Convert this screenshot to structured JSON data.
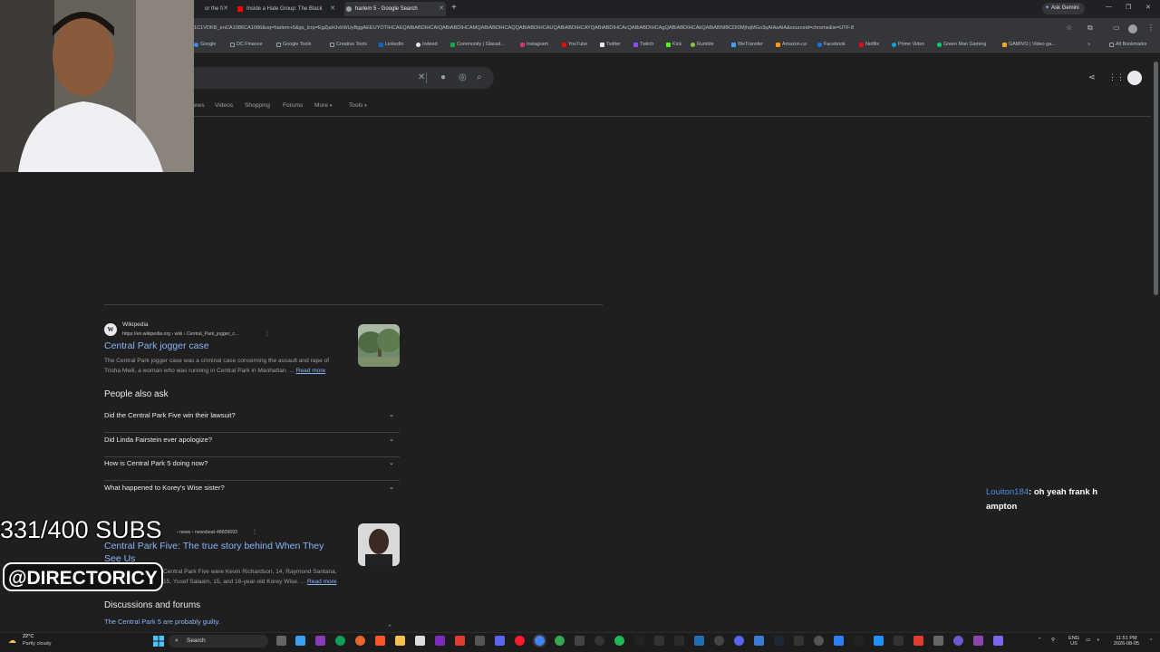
{
  "browser": {
    "tabs": [
      {
        "label": "or the fi",
        "close": "✕"
      },
      {
        "label": "Inside a Hate Group: The Black",
        "close": "✕"
      },
      {
        "label": "harlem 5 - Google Search",
        "close": "✕"
      }
    ],
    "new_tab": "+",
    "ask_gemini": "Ask Gemini",
    "window_controls": [
      "—",
      "❐",
      "✕"
    ],
    "url": "1C1VDKB_enCA1086CA1086&oq=harlem+5&gs_lcrp=EgZjaHJvbWUyBggAEEUYOTIHCAEQABiABDIHCAIQABiABDIHCAMQABiABDIHCAQQABiABDIHCAUQABiABDIHCAYQABiABDIHCAcQABiABDIHCAgQABiABDIHCAkQABiABNIBCDI0MjhqMGo3qAIAsAIA&sourceid=chrome&ie=UTF-8",
    "bookmarks": [
      {
        "label": "Google",
        "color": "#4285f4"
      },
      {
        "label": "DC Finance",
        "color": "#9aa0a6"
      },
      {
        "label": "Google Tools",
        "color": "#9aa0a6"
      },
      {
        "label": "Creative Tools",
        "color": "#9aa0a6"
      },
      {
        "label": "LinkedIn",
        "color": "#0a66c2"
      },
      {
        "label": "Indeed",
        "color": "#2164f3"
      },
      {
        "label": "Community | Glassd...",
        "color": "#0caa41"
      },
      {
        "label": "Instagram",
        "color": "#e1306c"
      },
      {
        "label": "YouTube",
        "color": "#ff0000"
      },
      {
        "label": "Twitter",
        "color": "#e8eaed"
      },
      {
        "label": "Twitch",
        "color": "#9146ff"
      },
      {
        "label": "Kick",
        "color": "#53fc18"
      },
      {
        "label": "Rumble",
        "color": "#85c742"
      },
      {
        "label": "WeTransfer",
        "color": "#409fff"
      },
      {
        "label": "Amazon.ca",
        "color": "#ff9900"
      },
      {
        "label": "Facebook",
        "color": "#1877f2"
      },
      {
        "label": "Netflix",
        "color": "#e50914"
      },
      {
        "label": "Prime Video",
        "color": "#00a8e1"
      },
      {
        "label": "Green Man Gaming",
        "color": "#00d26a"
      },
      {
        "label": "GAMIVO | Video ga...",
        "color": "#f5a623"
      }
    ],
    "all_bookmarks": "All Bookmarks"
  },
  "search": {
    "nav_tabs": [
      "ews",
      "Videos",
      "Shopping",
      "Forums",
      "More",
      "Tools"
    ]
  },
  "results": {
    "wiki": {
      "site_name": "Wikipedia",
      "site_url": "https://en.wikipedia.org › wiki › Central_Park_jogger_c...",
      "title": "Central Park jogger case",
      "snippet_1": "The Central Park jogger case was a criminal case concerning the assault and rape of",
      "snippet_2": "Trisha Meili, a woman who was running in Central Park in Manhattan. ...",
      "read_more": "Read more"
    },
    "paa": {
      "title": "People also ask",
      "questions": [
        "Did the Central Park Five win their lawsuit?",
        "Did Linda Fairstein ever apologize?",
        "How is Central Park 5 doing now?",
        "What happened to Korey's Wise sister?"
      ]
    },
    "news": {
      "site_url": "› news › newsbeat-48609693",
      "title_1": "Central Park Five: The true story behind When They",
      "title_2": "See Us",
      "snippet_1": "Central Park Five were Kevin Richardson, 14, Raymond Santana,",
      "snippet_2": "15, Yusef Salaam, 15, and 16-year-old Korey Wise. ...",
      "read_more": "Read more"
    },
    "discussions": {
      "title": "Discussions and forums",
      "link": "The Central Park 5 are probably guilty."
    }
  },
  "overlay": {
    "subs": "331/400 SUBS",
    "handle": "@DIRECTORICY",
    "chat_user": "Louiton184",
    "chat_message": ": oh yeah frank h ampton"
  },
  "taskbar": {
    "temp": "22°C",
    "weather": "Partly cloudy",
    "search": "Search",
    "lang_1": "ENG",
    "lang_2": "US",
    "time": "11:51 PM",
    "date": "2026-08-05"
  }
}
